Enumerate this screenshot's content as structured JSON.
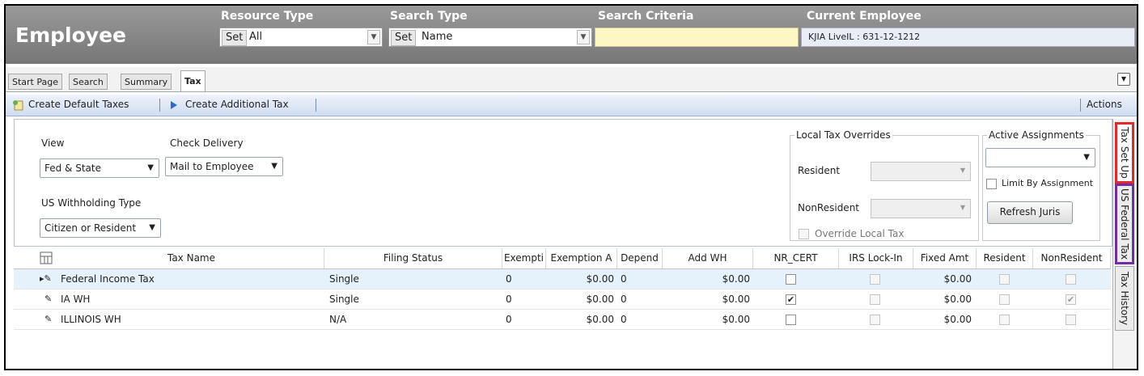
{
  "header": {
    "title": "Employee",
    "resource_type": {
      "label": "Resource Type",
      "set_label": "Set",
      "value": "All"
    },
    "search_type": {
      "label": "Search Type",
      "set_label": "Set",
      "value": "Name"
    },
    "search_criteria": {
      "label": "Search Criteria",
      "value": ""
    },
    "current_employee": {
      "label": "Current Employee",
      "value": "KJIA LiveIL : 631-12-1212"
    }
  },
  "tabs": [
    "Start Page",
    "Search",
    "Summary",
    "Tax"
  ],
  "active_tab": "Tax",
  "actions": {
    "create_default": "Create Default Taxes",
    "create_additional": "Create Additional Tax",
    "menu": "Actions"
  },
  "form": {
    "view": {
      "label": "View",
      "value": "Fed & State"
    },
    "check_delivery": {
      "label": "Check Delivery",
      "value": "Mail to Employee"
    },
    "us_withholding": {
      "label": "US Withholding Type",
      "value": "Citizen or Resident"
    },
    "local_tax": {
      "legend": "Local Tax Overrides",
      "resident_label": "Resident",
      "nonresident_label": "NonResident",
      "override_label": "Override Local Tax",
      "override_checked": false
    },
    "active_assignments": {
      "legend": "Active Assignments",
      "limit_label": "Limit By Assignment",
      "limit_checked": false,
      "refresh_label": "Refresh Juris"
    }
  },
  "grid": {
    "columns": [
      "Tax Name",
      "Filing Status",
      "Exempti",
      "Exemption A",
      "Depend",
      "Add WH",
      "NR_CERT",
      "IRS Lock-In",
      "Fixed Amt",
      "Resident",
      "NonResident"
    ],
    "rows": [
      {
        "tax_name": "Federal Income Tax",
        "filing_status": "Single",
        "exemptions": "0",
        "exemption_amt": "$0.00",
        "depend": "0",
        "add_wh": "$0.00",
        "nr_cert": false,
        "irs_lock": false,
        "fixed_amt": "$0.00",
        "resident": false,
        "nonresident": false
      },
      {
        "tax_name": "IA WH",
        "filing_status": "Single",
        "exemptions": "0",
        "exemption_amt": "$0.00",
        "depend": "0",
        "add_wh": "$0.00",
        "nr_cert": true,
        "irs_lock": false,
        "fixed_amt": "$0.00",
        "resident": false,
        "nonresident": true
      },
      {
        "tax_name": "ILLINOIS WH",
        "filing_status": "N/A",
        "exemptions": "0",
        "exemption_amt": "$0.00",
        "depend": "0",
        "add_wh": "$0.00",
        "nr_cert": false,
        "irs_lock": false,
        "fixed_amt": "$0.00",
        "resident": false,
        "nonresident": false
      }
    ]
  },
  "side_tabs": [
    "Tax Set Up",
    "US Federal Tax",
    "Tax History"
  ],
  "colors": {
    "header_bg": "#8a8a8a",
    "criteria_bg": "#fdf7c3",
    "highlight_red": "#e02b2b",
    "highlight_purple": "#6e2fa0",
    "selected_row": "#e5f1fb"
  }
}
